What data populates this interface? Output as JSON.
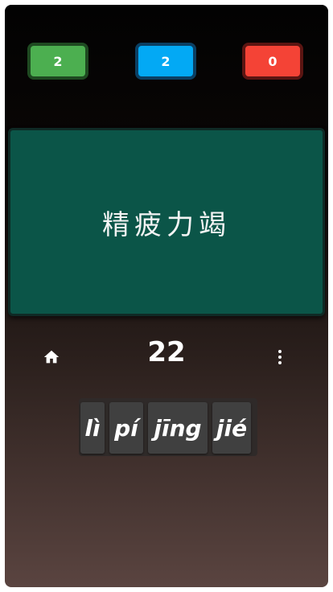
{
  "scores": {
    "green": "2",
    "blue": "2",
    "red": "0"
  },
  "card": {
    "text": "精疲力竭"
  },
  "nav": {
    "home_icon": "home-icon",
    "count": "22",
    "menu_icon": "more-vertical-icon"
  },
  "tiles": [
    {
      "label": "lì"
    },
    {
      "label": "pí"
    },
    {
      "label": "jīng"
    },
    {
      "label": "jié"
    }
  ],
  "colors": {
    "green": "#4caf50",
    "blue": "#03a9f4",
    "red": "#f44336",
    "card": "#0b5548"
  }
}
